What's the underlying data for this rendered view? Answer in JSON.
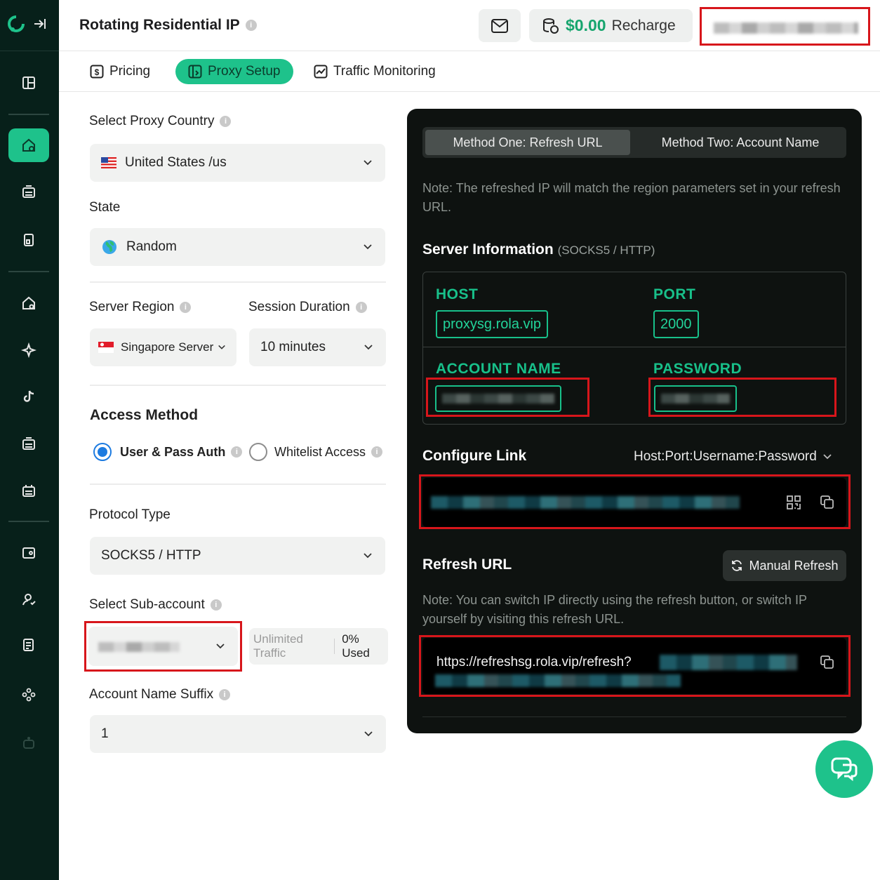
{
  "app": {
    "title": "Rotating Residential IP"
  },
  "header": {
    "balance": "$0.00",
    "recharge_label": "Recharge"
  },
  "tabs": [
    {
      "label": "Pricing",
      "icon": "dollar-icon"
    },
    {
      "label": "Proxy Setup",
      "icon": "setup-icon",
      "active": true
    },
    {
      "label": "Traffic Monitoring",
      "icon": "chart-icon"
    }
  ],
  "form": {
    "country_label": "Select Proxy Country",
    "country_value": "United States /us",
    "state_label": "State",
    "state_value": "Random",
    "region_label": "Server Region",
    "region_value": "Singapore Server",
    "duration_label": "Session Duration",
    "duration_value": "10 minutes",
    "access_label": "Access Method",
    "access_options": [
      {
        "label": "User & Pass Auth",
        "selected": true
      },
      {
        "label": "Whitelist Access",
        "selected": false
      }
    ],
    "protocol_label": "Protocol Type",
    "protocol_value": "SOCKS5 / HTTP",
    "subaccount_label": "Select Sub-account",
    "traffic_label": "Unlimited Traffic",
    "used_label": "0% Used",
    "suffix_label": "Account Name Suffix",
    "suffix_value": "1"
  },
  "panel": {
    "methods": [
      {
        "label": "Method One: Refresh URL",
        "active": true
      },
      {
        "label": "Method Two: Account Name",
        "active": false
      }
    ],
    "note_region": "Note: The refreshed IP will match the region parameters set in your refresh URL.",
    "server_title": "Server Information",
    "server_sub": "(SOCKS5 / HTTP)",
    "host_label": "HOST",
    "host_value": "proxysg.rola.vip",
    "port_label": "PORT",
    "port_value": "2000",
    "account_label": "ACCOUNT NAME",
    "password_label": "PASSWORD",
    "configure_title": "Configure Link",
    "configure_format": "Host:Port:Username:Password",
    "refresh_title": "Refresh URL",
    "manual_refresh": "Manual Refresh",
    "note_refresh": "Note: You can switch IP directly using the refresh button, or switch IP yourself by visiting this refresh URL.",
    "refresh_url": "https://refreshsg.rola.vip/refresh?"
  },
  "colors": {
    "accent": "#1ec28b",
    "sidebar": "#07201a",
    "panel": "#0e1210",
    "redact": "#d7161b"
  }
}
